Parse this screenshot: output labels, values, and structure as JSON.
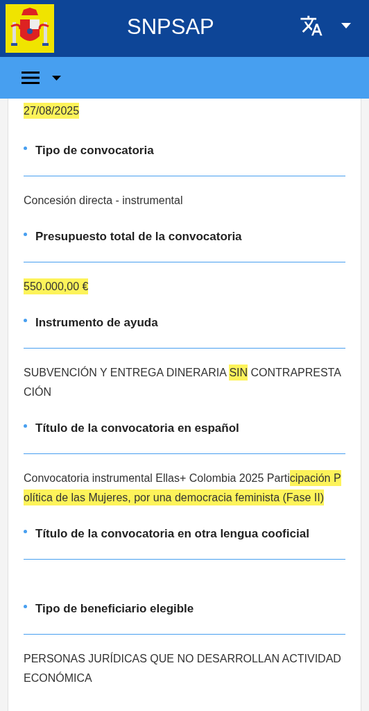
{
  "header": {
    "title": "SNPSAP"
  },
  "leading_value": {
    "parts": [
      {
        "text": "27/08/2025",
        "highlighted": true
      }
    ]
  },
  "fields": [
    {
      "label": "Tipo de convocatoria",
      "parts": [
        {
          "text": "Concesión directa - instrumental",
          "highlighted": false
        }
      ]
    },
    {
      "label": "Presupuesto total de la convocatoria",
      "parts": [
        {
          "text": "550.000,00 €",
          "highlighted": true
        }
      ]
    },
    {
      "label": "Instrumento de ayuda",
      "parts": [
        {
          "text": "SUBVENCIÓN Y ENTREGA DINERARIA ",
          "highlighted": false
        },
        {
          "text": "SIN",
          "highlighted": true
        },
        {
          "text": " CONTRAPRESTACIÓN",
          "highlighted": false
        }
      ]
    },
    {
      "label": "Título de la convocatoria en español",
      "parts": [
        {
          "text": "Convocatoria instrumental Ellas+ Colombia 2025 Parti",
          "highlighted": false
        },
        {
          "text": "cipación Política de las Mujeres, por una democracia feminista (Fase II)",
          "highlighted": true
        }
      ]
    },
    {
      "label": "Título de la convocatoria en otra lengua cooficial"
    },
    {
      "label": "Tipo de beneficiario elegible",
      "parts": [
        {
          "text": "PERSONAS JURÍDICAS QUE NO DESARROLLAN ACTIVIDAD ECONÓMICA",
          "highlighted": false
        }
      ]
    }
  ]
}
